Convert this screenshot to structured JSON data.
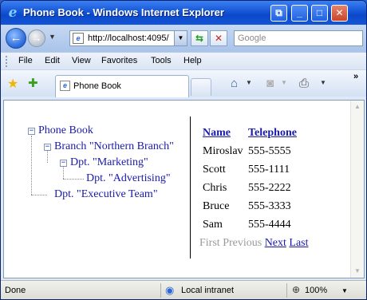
{
  "window": {
    "title": "Phone Book - Windows Internet Explorer",
    "minimize": "_",
    "maximize": "□",
    "close": "✕",
    "compat": "⧉"
  },
  "address_bar": {
    "url": "http://localhost:4095/",
    "search_placeholder": "Google"
  },
  "menu": [
    "File",
    "Edit",
    "View",
    "Favorites",
    "Tools",
    "Help"
  ],
  "tabs": [
    {
      "label": "Phone Book"
    }
  ],
  "tree": {
    "root": "Phone Book",
    "branch": "Branch \"Northern Branch\"",
    "marketing": "Dpt. \"Marketing\"",
    "advertising": "Dpt. \"Advertising\"",
    "executive": "Dpt. \"Executive Team\""
  },
  "grid": {
    "headers": {
      "name": "Name",
      "telephone": "Telephone"
    },
    "rows": [
      {
        "name": "Miroslav",
        "telephone": "555-5555"
      },
      {
        "name": "Scott",
        "telephone": "555-1111"
      },
      {
        "name": "Chris",
        "telephone": "555-2222"
      },
      {
        "name": "Bruce",
        "telephone": "555-3333"
      },
      {
        "name": "Sam",
        "telephone": "555-4444"
      }
    ],
    "pager": {
      "first": "First",
      "previous": "Previous",
      "next": "Next",
      "last": "Last"
    }
  },
  "status": {
    "text": "Done",
    "zone": "Local intranet",
    "zoom": "100%"
  },
  "icons": {
    "ie": "ie-logo-icon",
    "back": "back-arrow-icon",
    "forward": "forward-arrow-icon",
    "favorites": "star-icon",
    "add_favorites": "add-favorites-icon",
    "home": "home-icon",
    "feeds": "rss-feed-icon",
    "print": "printer-icon",
    "zone": "globe-computer-icon",
    "zoom": "magnifier-icon"
  }
}
